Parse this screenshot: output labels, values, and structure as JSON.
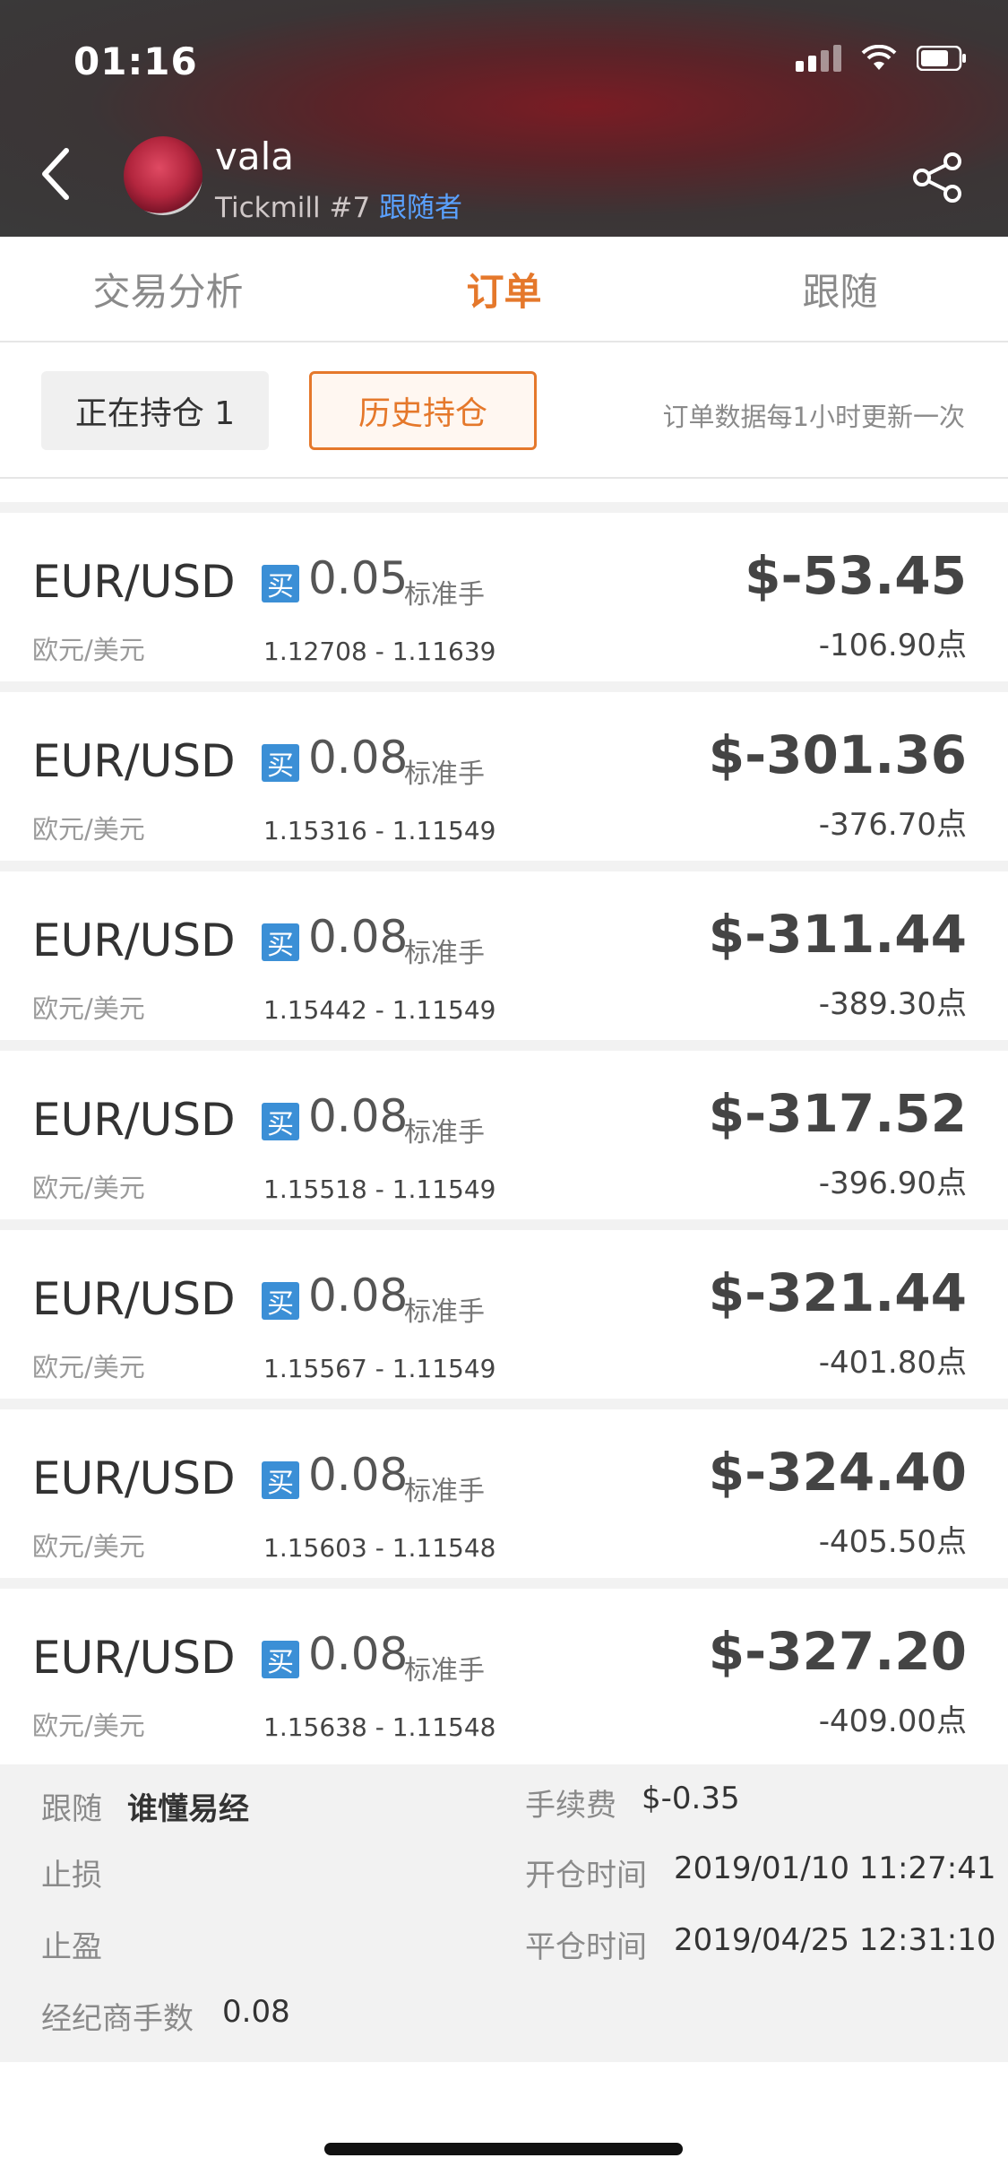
{
  "status": {
    "time": "01:16"
  },
  "header": {
    "name": "vala",
    "broker": "Tickmill #7",
    "follower_link": "跟随者"
  },
  "tabs": [
    "交易分析",
    "订单",
    "跟随"
  ],
  "active_tab": 1,
  "filters": {
    "open": "正在持仓 1",
    "history": "历史持仓",
    "hint": "订单数据每1小时更新一次"
  },
  "orders": [
    {
      "symbol": "EUR/USD",
      "symbol_cn": "欧元/美元",
      "side": "买",
      "lots": "0.05",
      "unit": "标准手",
      "prices": "1.12708 - 1.11639",
      "pnl": "$-53.45",
      "points": "-106.90点"
    },
    {
      "symbol": "EUR/USD",
      "symbol_cn": "欧元/美元",
      "side": "买",
      "lots": "0.08",
      "unit": "标准手",
      "prices": "1.15316 - 1.11549",
      "pnl": "$-301.36",
      "points": "-376.70点"
    },
    {
      "symbol": "EUR/USD",
      "symbol_cn": "欧元/美元",
      "side": "买",
      "lots": "0.08",
      "unit": "标准手",
      "prices": "1.15442 - 1.11549",
      "pnl": "$-311.44",
      "points": "-389.30点"
    },
    {
      "symbol": "EUR/USD",
      "symbol_cn": "欧元/美元",
      "side": "买",
      "lots": "0.08",
      "unit": "标准手",
      "prices": "1.15518 - 1.11549",
      "pnl": "$-317.52",
      "points": "-396.90点"
    },
    {
      "symbol": "EUR/USD",
      "symbol_cn": "欧元/美元",
      "side": "买",
      "lots": "0.08",
      "unit": "标准手",
      "prices": "1.15567 - 1.11549",
      "pnl": "$-321.44",
      "points": "-401.80点"
    },
    {
      "symbol": "EUR/USD",
      "symbol_cn": "欧元/美元",
      "side": "买",
      "lots": "0.08",
      "unit": "标准手",
      "prices": "1.15603 - 1.11548",
      "pnl": "$-324.40",
      "points": "-405.50点"
    },
    {
      "symbol": "EUR/USD",
      "symbol_cn": "欧元/美元",
      "side": "买",
      "lots": "0.08",
      "unit": "标准手",
      "prices": "1.15638 - 1.11548",
      "pnl": "$-327.20",
      "points": "-409.00点"
    }
  ],
  "detail": {
    "follow_label": "跟随",
    "follow_value": "谁懂易经",
    "fee_label": "手续费",
    "fee_value": "$-0.35",
    "stoploss_label": "止损",
    "open_time_label": "开仓时间",
    "open_time_value": "2019/01/10 11:27:41",
    "takeprofit_label": "止盈",
    "close_time_label": "平仓时间",
    "close_time_value": "2019/04/25 12:31:10",
    "broker_lots_label": "经纪商手数",
    "broker_lots_value": "0.08"
  },
  "colors": {
    "accent": "#e5782b",
    "link": "#5aa1ff",
    "buy_badge": "#3b8fd6"
  }
}
